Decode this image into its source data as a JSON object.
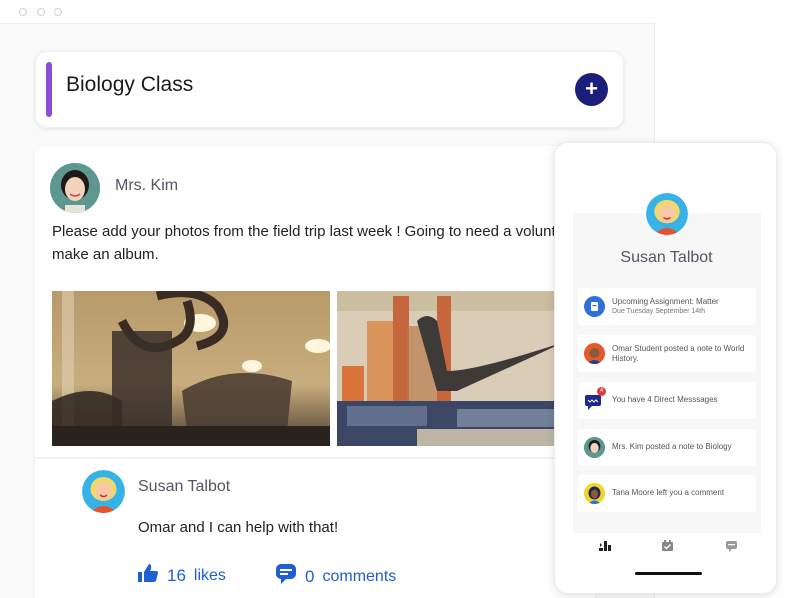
{
  "class": {
    "title": "Biology Class",
    "add_label": "+",
    "accent_color": "#8a4fd6"
  },
  "post": {
    "author": "Mrs. Kim",
    "text_line1": "Please add your photos from the field trip last week ! Going to need a volunt",
    "text_line2": "make an album.",
    "photos": [
      {
        "subject": "mammoth skeletons museum hall"
      },
      {
        "subject": "dinosaur skeleton rotunda with crowd"
      }
    ]
  },
  "reply": {
    "author": "Susan Talbot",
    "text": "Omar and I can help with that!",
    "likes_count": "16",
    "likes_label": "likes",
    "comments_count": "0",
    "comments_label": "comments"
  },
  "phone": {
    "user_name": "Susan Talbot",
    "notifications": [
      {
        "icon": "assignment-icon",
        "line1": "Upcoming Assignment: Matter",
        "line2": "Due Tuesday September 14th"
      },
      {
        "icon": "omar-avatar",
        "line1": "Omar Student posted a note to World",
        "line2": "History."
      },
      {
        "icon": "direct-message-icon",
        "line1": "You have 4 Direct Messsages",
        "line2": "",
        "badge": "4"
      },
      {
        "icon": "mrs-kim-avatar",
        "line1": "Mrs. Kim posted a note to Biology",
        "line2": ""
      },
      {
        "icon": "tana-avatar",
        "line1": "Tana Moore left you a comment",
        "line2": ""
      }
    ],
    "tabs": [
      "feed-icon",
      "assignments-icon",
      "messages-icon"
    ]
  },
  "colors": {
    "brand_navy": "#1c1f7a",
    "link_blue": "#1f5fd0"
  }
}
